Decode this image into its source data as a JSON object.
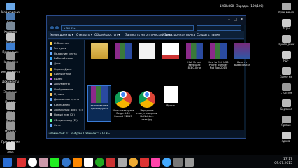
{
  "desktop": {
    "left_icons": [
      {
        "label": "Мой компьютер",
        "color": "#6aa8e8"
      },
      {
        "label": "Сеть",
        "color": "#4d7ab0"
      },
      {
        "label": "Корзина",
        "color": "#7a8a99"
      },
      {
        "label": "studio",
        "color": "#c8c8c8"
      },
      {
        "label": "Проводник",
        "color": "#3f7fd0"
      },
      {
        "label": "Настройки",
        "color": "#999"
      },
      {
        "label": "инструменты",
        "color": "#888"
      },
      {
        "label": "Документы",
        "color": "#bbb"
      },
      {
        "label": "Загрузки",
        "color": "#aaa"
      },
      {
        "label": "Панель",
        "color": "#777"
      },
      {
        "label": "Фото",
        "color": "#b0b0b0"
      },
      {
        "label": "Видео",
        "color": "#999"
      },
      {
        "label": "Музыка",
        "color": "#999"
      },
      {
        "label": "Приложения",
        "color": "#8a8a8a"
      },
      {
        "label": "asus",
        "color": "#ddd"
      }
    ],
    "right_icons": [
      {
        "label": "пуск меню",
        "color": "#aaa"
      },
      {
        "label": "Игры",
        "color": "#ccc"
      },
      {
        "label": "Проводник",
        "color": "#bbb"
      },
      {
        "label": "PDF",
        "color": "#ccc"
      },
      {
        "label": "Заметки",
        "color": "#bbb"
      },
      {
        "label": "стол ум",
        "color": "#999"
      },
      {
        "label": "Корзина",
        "color": "#bbb"
      },
      {
        "label": "Ярлык",
        "color": "#aaa"
      },
      {
        "label": "Архив",
        "color": "#ccc"
      }
    ],
    "top_tray": {
      "resolution": "1280x800",
      "status": "Зарядка (100/100)"
    }
  },
  "window": {
    "address": "« asus  »",
    "menu": [
      "Упорядочить ▾",
      "Открыть ▾",
      "Общий доступ ▾",
      "Записать на оптический диск",
      "Электронная почта",
      "Создать папку"
    ],
    "nav_items": [
      {
        "label": "Избранное",
        "color": "#ffd24a"
      },
      {
        "label": "Загрузки",
        "color": "#6af"
      },
      {
        "label": "Недавние места",
        "color": "#6af"
      },
      {
        "label": "Рабочий стол",
        "color": "#3af"
      },
      {
        "label": "Диск",
        "color": "#9cf"
      },
      {
        "label": "Яндекс.Диск",
        "color": "#fc3"
      },
      {
        "label": "Библиотеки",
        "color": "#fc3"
      },
      {
        "label": "Видео",
        "color": "#c6f"
      },
      {
        "label": "Документы",
        "color": "#ccf"
      },
      {
        "label": "Изображения",
        "color": "#6cf"
      },
      {
        "label": "Музыка",
        "color": "#fc6"
      },
      {
        "label": "Домашняя группа",
        "color": "#6af"
      },
      {
        "label": "Компьютер",
        "color": "#9cf"
      },
      {
        "label": "Локальный диск (C:)",
        "color": "#ccc"
      },
      {
        "label": "Новый том (D:)",
        "color": "#ccc"
      },
      {
        "label": "CD-дисковод (E:)",
        "color": "#6f9"
      },
      {
        "label": "Сеть",
        "color": "#6af"
      }
    ],
    "files": [
      {
        "label": "",
        "thumb": "folder"
      },
      {
        "label": "",
        "thumb": "archive"
      },
      {
        "label": "",
        "thumb": "doc"
      },
      {
        "label": "",
        "thumb": "doc2"
      },
      {
        "label": "Hot Virtual Keyboard 8.3.0.0.rar",
        "thumb": "archive"
      },
      {
        "label": "How to Exit USB Phone Number Not Box 2015",
        "thumb": "archive"
      },
      {
        "label": "Kazan и asdditios.rar",
        "thumb": "archive2"
      },
      {
        "label": "акактивтов в адоподзу.rar",
        "thumb": "archive"
      },
      {
        "label": "Мультизагрузка Ex.gb 4.86 Format 12015",
        "thumb": "chrome"
      },
      {
        "label": "Чередные статус в версии DeNet.bc - стат.jpg",
        "thumb": "chrome"
      },
      {
        "label": "Ярлык",
        "thumb": "text"
      }
    ],
    "status": "Элементов: 11   Выбран 1 элемент: 774 КБ"
  },
  "taskbar": {
    "apps": [
      "#2b6fd6",
      "#d33",
      "#fff",
      "#c9a",
      "#2e2",
      "#37c",
      "#f80",
      "#fff",
      "#2a2",
      "#c33",
      "#aaa",
      "#ea3",
      "#d33",
      "#f4a",
      "#4af",
      "#777",
      "#999"
    ],
    "time": "17:17",
    "date": "09.07.2015"
  }
}
